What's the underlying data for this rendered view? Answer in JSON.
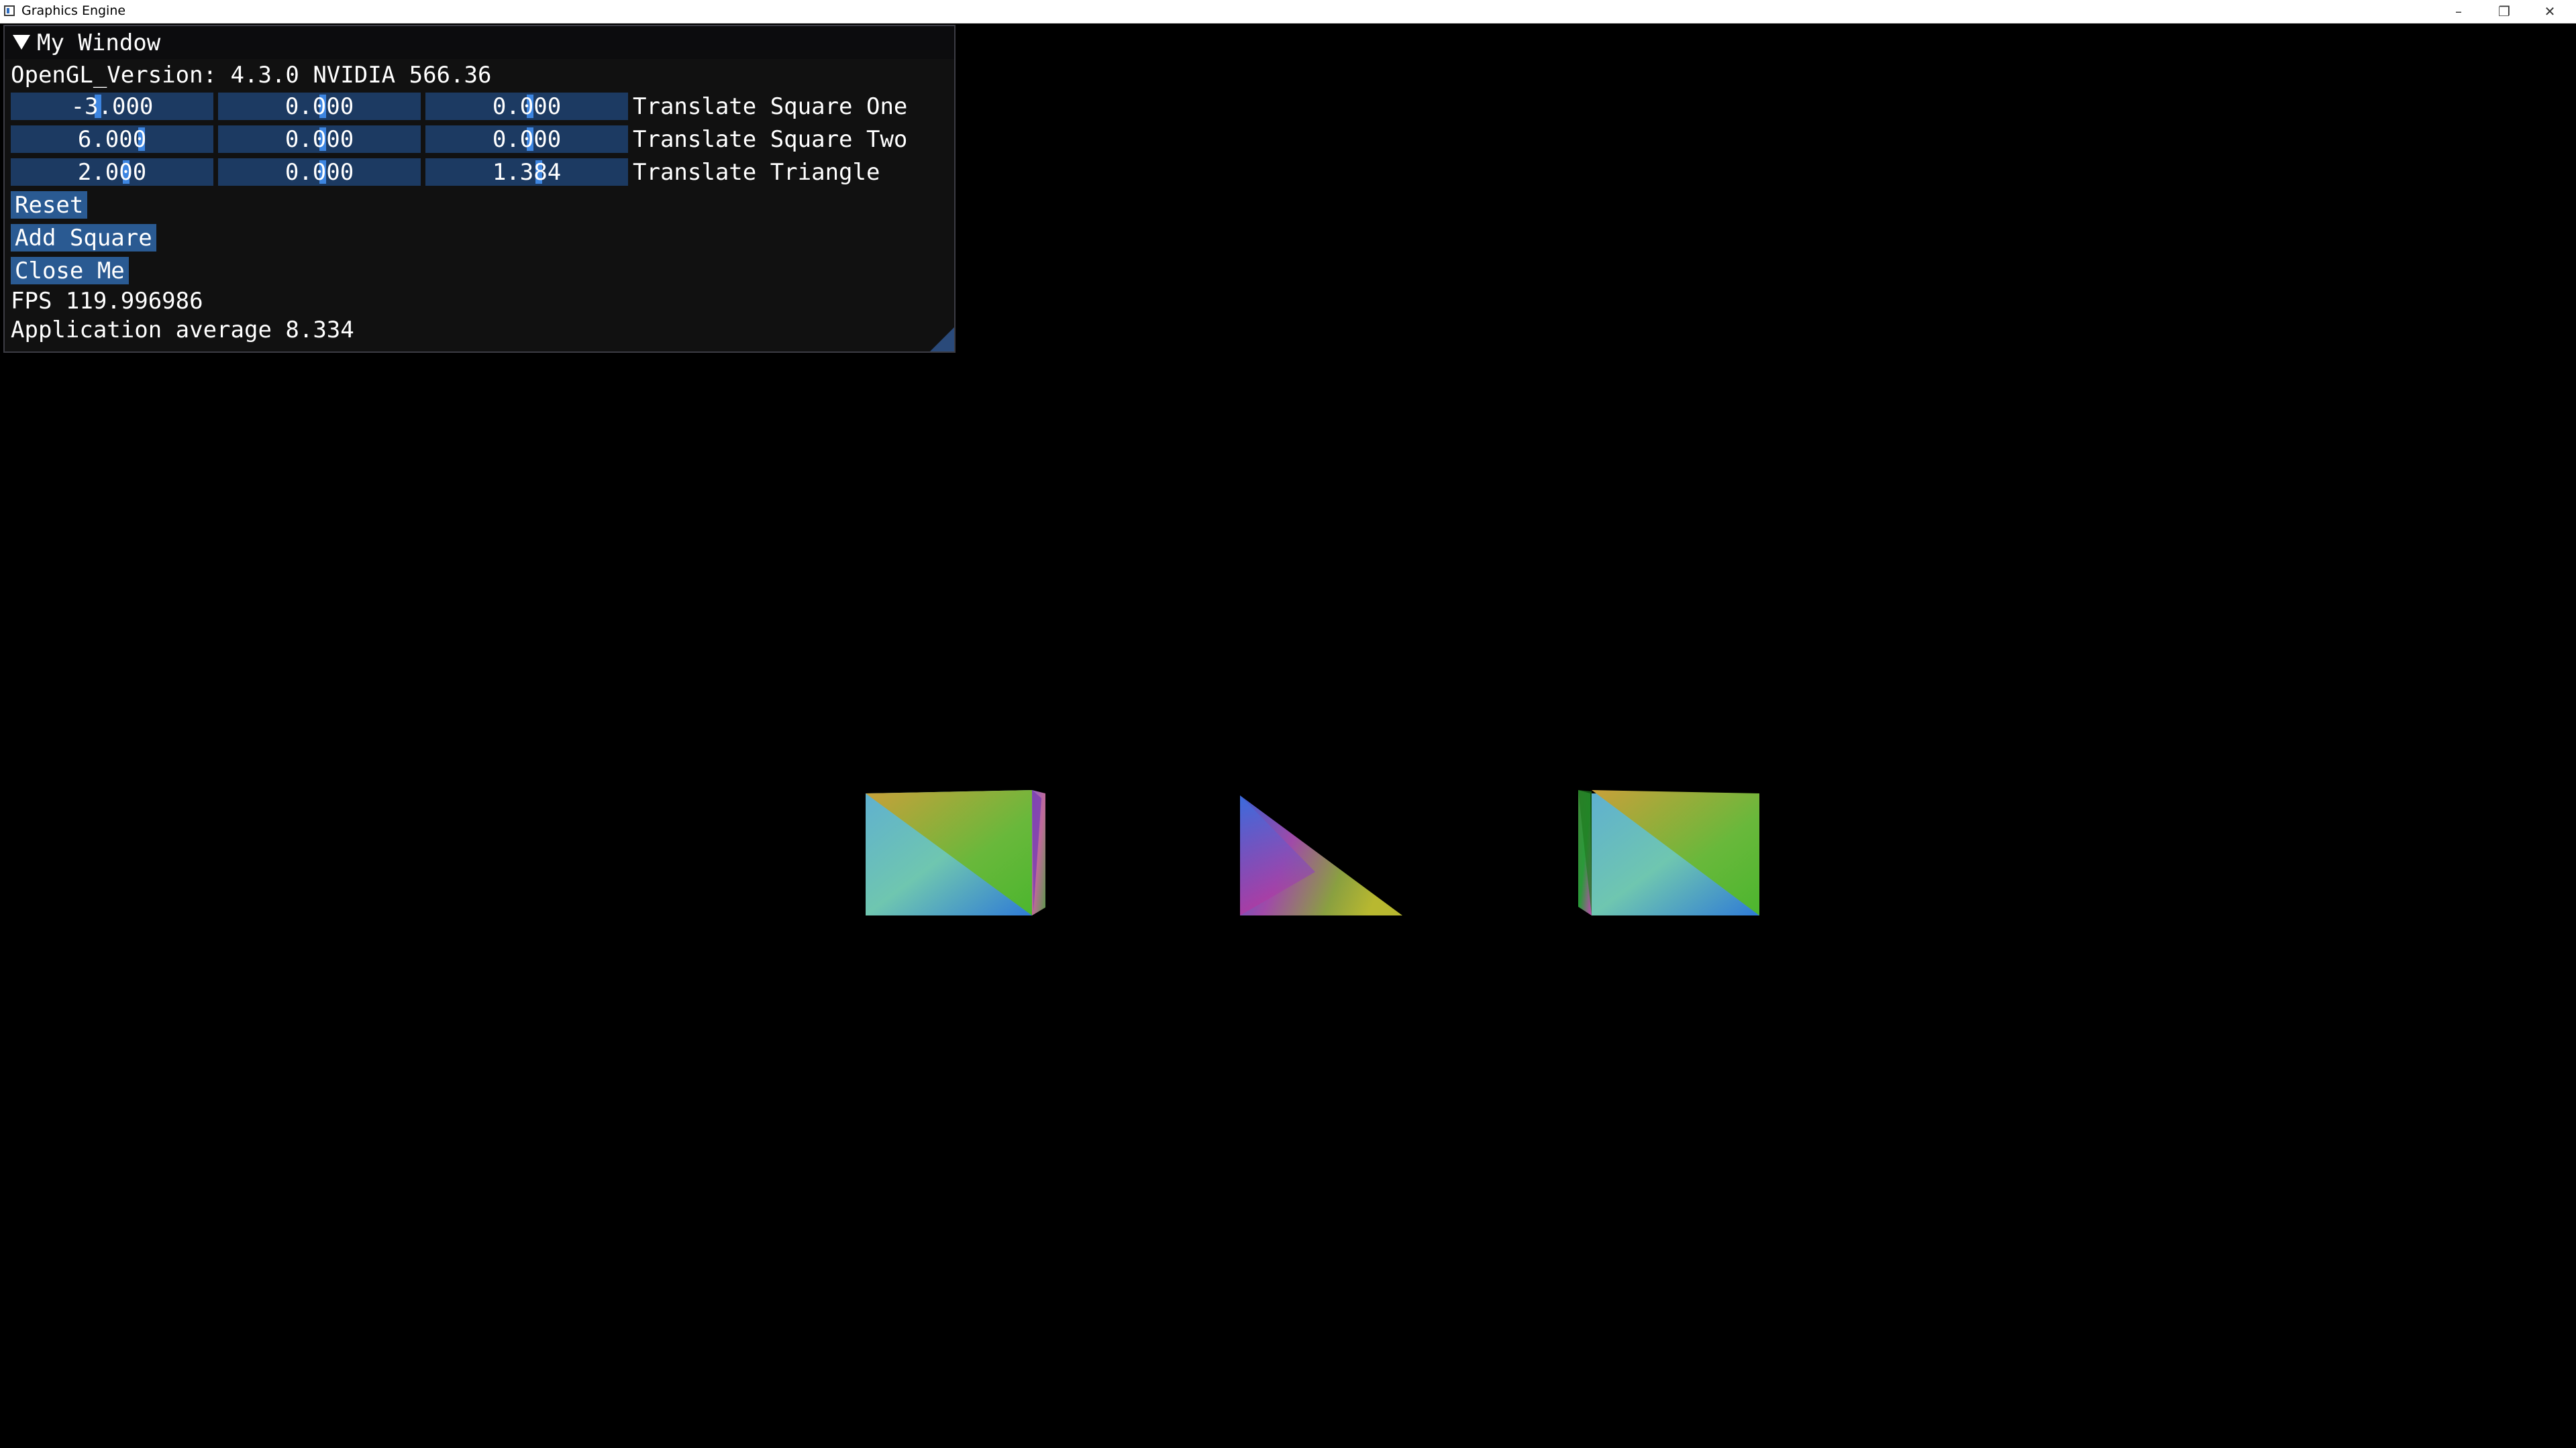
{
  "os_window": {
    "title": "Graphics Engine",
    "minimize_glyph": "–",
    "maximize_glyph": "❐",
    "close_glyph": "✕"
  },
  "imgui": {
    "title": "My Window",
    "opengl_version": "OpenGL_Version: 4.3.0 NVIDIA 566.36",
    "rows": [
      {
        "label": "Translate Square One",
        "values": [
          "-3.000",
          "0.000",
          "0.000"
        ]
      },
      {
        "label": "Translate Square Two",
        "values": [
          "6.000",
          "0.000",
          "0.000"
        ]
      },
      {
        "label": "Translate Triangle",
        "values": [
          "2.000",
          "0.000",
          "1.384"
        ]
      }
    ],
    "buttons": {
      "reset": "Reset",
      "add_square": "Add Square",
      "close_me": "Close Me"
    },
    "fps": "FPS 119.996986",
    "app_average": "Application average 8.334"
  },
  "colors": {
    "background": "#000000",
    "frame_bg": "#1c3a62",
    "button_bg": "#2a5a92",
    "slider_grab": "#3d85e0",
    "window_bg": "#121212"
  }
}
